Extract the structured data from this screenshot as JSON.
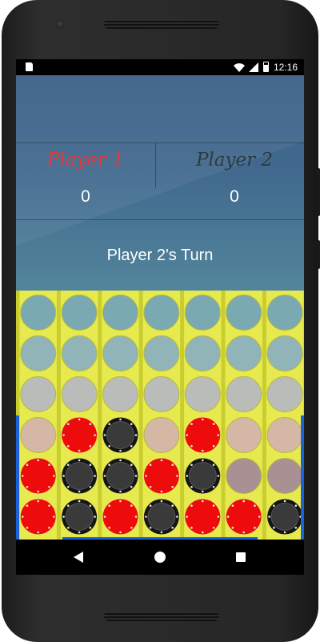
{
  "status_bar": {
    "time": "12:16"
  },
  "players": [
    {
      "name": "Player 1",
      "score": "0",
      "color": "#e63838"
    },
    {
      "name": "Player 2",
      "score": "0",
      "color": "#2d3b41"
    }
  ],
  "turn_text": "Player 2's Turn",
  "board": {
    "columns": 7,
    "rows": 6,
    "grid": [
      [
        "empty",
        "empty",
        "empty",
        "empty",
        "empty",
        "empty",
        "empty"
      ],
      [
        "empty",
        "empty",
        "empty",
        "empty",
        "empty",
        "empty",
        "empty"
      ],
      [
        "empty",
        "empty",
        "empty",
        "empty",
        "empty",
        "empty",
        "empty"
      ],
      [
        "empty",
        "red",
        "black",
        "empty",
        "red",
        "empty",
        "empty"
      ],
      [
        "red",
        "black",
        "black",
        "red",
        "black",
        "empty",
        "empty"
      ],
      [
        "red",
        "black",
        "red",
        "black",
        "red",
        "red",
        "black"
      ]
    ],
    "colors": {
      "red": "#ee0b0b",
      "black": "#3a3a3a",
      "board": "#e6ea4e",
      "frame": "#1b62d8"
    }
  },
  "nav": {
    "back": "back-icon",
    "home": "home-icon",
    "recents": "recents-icon"
  }
}
